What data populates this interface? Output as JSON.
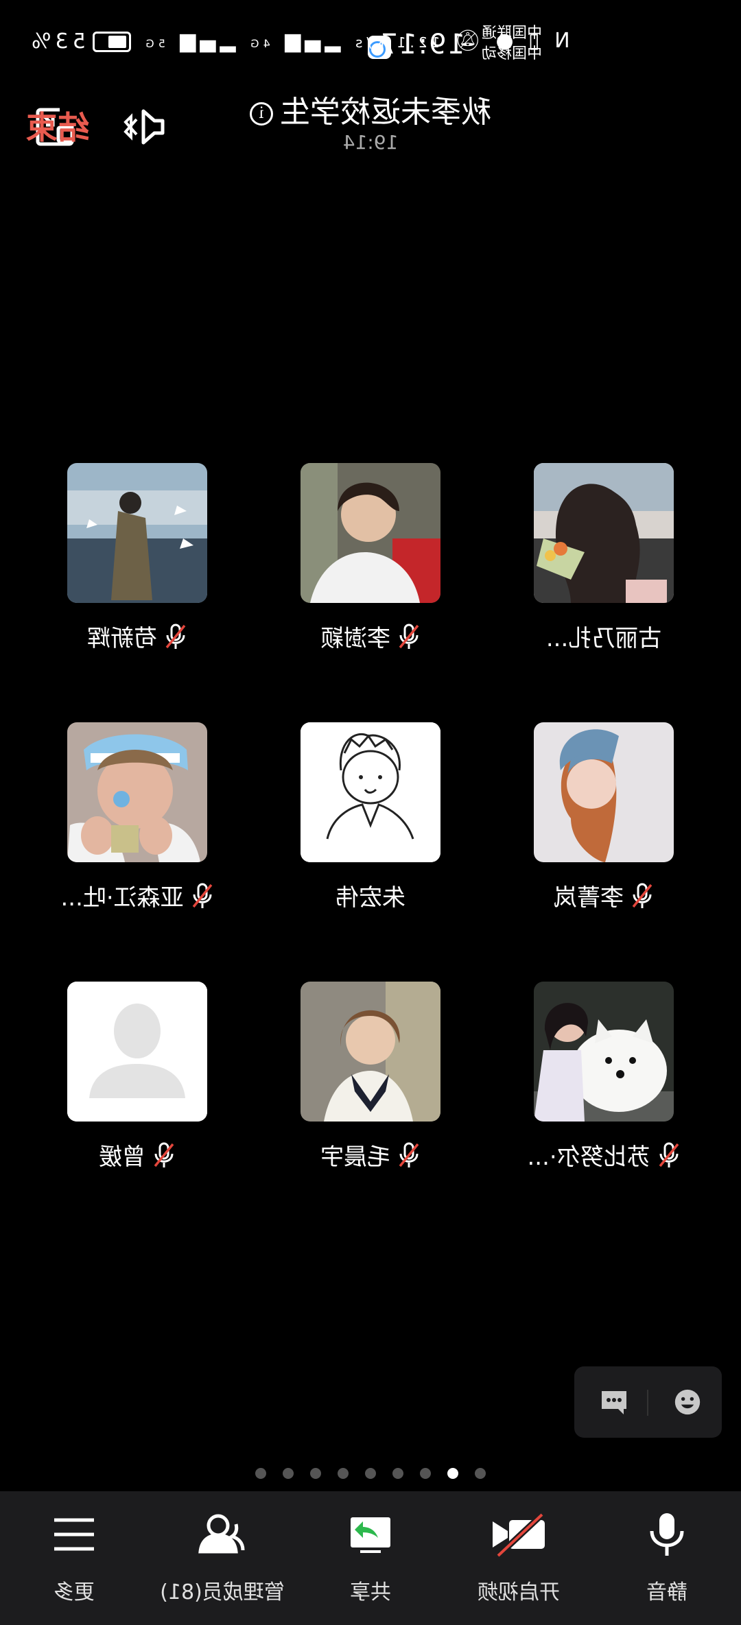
{
  "status_bar": {
    "carrier_1": "中国联通",
    "carrier_2": "中国移动",
    "time": "19:17",
    "network_speed": "12.1 K/s",
    "signal_1": "4G",
    "signal_2": "5G",
    "battery": "53%"
  },
  "header": {
    "title": "秋季未返校学生",
    "duration": "19:14",
    "end_label": "结束"
  },
  "participants": [
    {
      "name": "古丽乃扎...",
      "muted": false,
      "avatar": "woman-flowers-car"
    },
    {
      "name": "李澍颖",
      "muted": true,
      "avatar": "boy-white-shirt"
    },
    {
      "name": "苟新辉",
      "muted": true,
      "avatar": "man-coat-seaside"
    },
    {
      "name": "李菁岚",
      "muted": true,
      "avatar": "girl-hood-illustration"
    },
    {
      "name": "朱宏伟",
      "muted": false,
      "avatar": "sketch-boy"
    },
    {
      "name": "亚森江·吐...",
      "muted": true,
      "avatar": "boy-argentina-fan"
    },
    {
      "name": "苏比努尔·...",
      "muted": true,
      "avatar": "girl-with-dog"
    },
    {
      "name": "毛晨宇",
      "muted": true,
      "avatar": "boy-sailor-uniform"
    },
    {
      "name": "曾媛",
      "muted": true,
      "avatar": "default-avatar"
    }
  ],
  "pagination": {
    "total": 9,
    "active_index": 1
  },
  "toolbar": {
    "mute": "静音",
    "video": "开启视频",
    "share": "共享",
    "members": "管理成员(81)",
    "more": "更多"
  },
  "colors": {
    "end": "#e85b4f",
    "toolbar_bg": "#1c1c1e",
    "share_green": "#2db84d"
  }
}
